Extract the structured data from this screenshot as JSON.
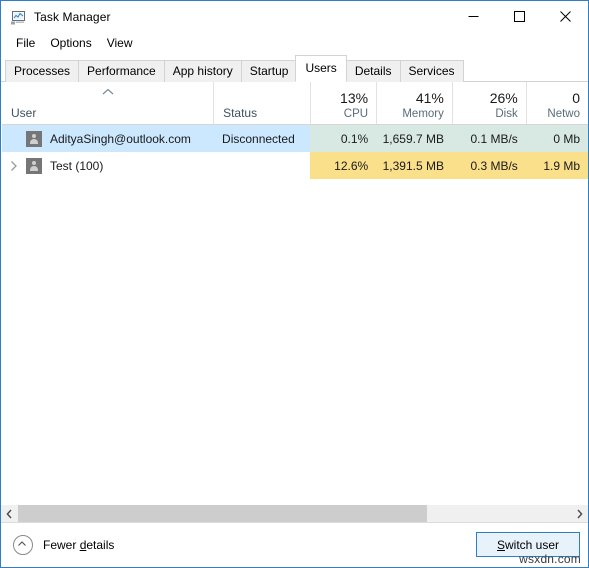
{
  "window": {
    "title": "Task Manager",
    "icon": "task-manager-icon",
    "controls": {
      "minimize": "minimize-icon",
      "maximize": "maximize-icon",
      "close": "close-icon"
    },
    "border_color": "#2f7fc4"
  },
  "menubar": {
    "items": [
      {
        "label": "File"
      },
      {
        "label": "Options"
      },
      {
        "label": "View"
      }
    ]
  },
  "tabs": {
    "items": [
      {
        "label": "Processes",
        "active": false
      },
      {
        "label": "Performance",
        "active": false
      },
      {
        "label": "App history",
        "active": false
      },
      {
        "label": "Startup",
        "active": false
      },
      {
        "label": "Users",
        "active": true
      },
      {
        "label": "Details",
        "active": false
      },
      {
        "label": "Services",
        "active": false
      }
    ]
  },
  "table": {
    "columns": [
      {
        "key": "user",
        "label": "User",
        "pct": "",
        "align": "left",
        "sorted": "asc",
        "sort_icon": "sort-ascending-icon"
      },
      {
        "key": "status",
        "label": "Status",
        "pct": "",
        "align": "left"
      },
      {
        "key": "cpu",
        "label": "CPU",
        "pct": "13%",
        "align": "right"
      },
      {
        "key": "memory",
        "label": "Memory",
        "pct": "41%",
        "align": "right"
      },
      {
        "key": "disk",
        "label": "Disk",
        "pct": "26%",
        "align": "right"
      },
      {
        "key": "network",
        "label": "Netwo",
        "pct": "0",
        "align": "right"
      }
    ],
    "rows": [
      {
        "user": "AdityaSingh@outlook.com",
        "status": "Disconnected",
        "cpu": "0.1%",
        "memory": "1,659.7 MB",
        "disk": "0.1 MB/s",
        "network": "0 Mb",
        "selected": true,
        "expandable": false,
        "icon": "user-account-icon"
      },
      {
        "user": "Test (100)",
        "status": "",
        "cpu": "12.6%",
        "memory": "1,391.5 MB",
        "disk": "0.3 MB/s",
        "network": "1.9 Mb",
        "selected": false,
        "expandable": true,
        "expander_icon": "chevron-right-icon",
        "icon": "user-account-icon"
      }
    ],
    "heat_colors": {
      "row0": "#d8e9e4",
      "row1": "#fbe08b"
    }
  },
  "scrollbar": {
    "left_arrow": "chevron-left-icon",
    "right_arrow": "chevron-right-icon",
    "thumb_start_pct": 0,
    "thumb_width_pct": 74
  },
  "statusbar": {
    "fewer_details": {
      "prefix": "Fewer ",
      "accel": "d",
      "suffix": "etails",
      "icon": "chevron-up-circle-icon"
    },
    "switch_user": {
      "accel": "S",
      "suffix": "witch user"
    }
  },
  "watermark": "wsxdn.com"
}
